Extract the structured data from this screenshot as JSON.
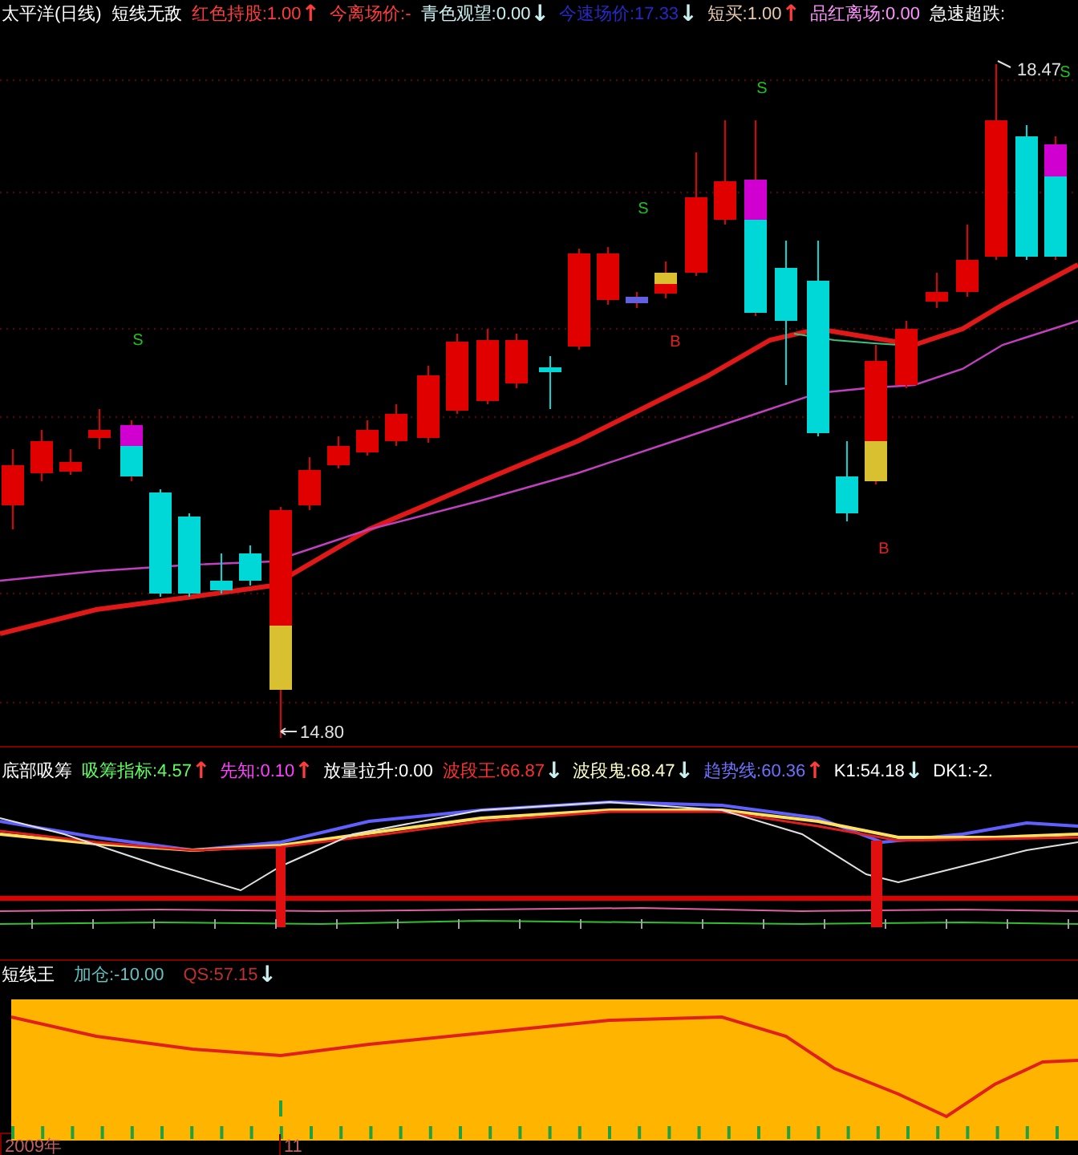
{
  "main_panel": {
    "title": "太平洋(日线)",
    "indicator_name": "短线无敌",
    "indicators": [
      {
        "text": "红色持股:1.00",
        "arrow": {
          "text": "↑",
          "color": "#ff3c3c"
        },
        "color": "#ff3c3c"
      },
      {
        "text": "今离场价:-",
        "color": "#ff3c3c"
      },
      {
        "text": "青色观望:0.00",
        "arrow": {
          "text": "↓",
          "color": "#c8f0f0"
        },
        "color": "#c8f0f0"
      },
      {
        "text": "今速场价:17.33",
        "arrow": {
          "text": "↓",
          "color": "#c8f0f0"
        },
        "color": "#2828c8"
      },
      {
        "text": "短买:1.00",
        "arrow": {
          "text": "↑",
          "color": "#ff3c3c"
        },
        "color": "#e8c8a8"
      },
      {
        "text": "品红离场:0.00",
        "color": "#ff90ff"
      },
      {
        "text": "急速超跌:",
        "color": "#ffffff"
      }
    ],
    "high_label": "18.47",
    "low_label": "14.80",
    "signals": [
      {
        "text": "S",
        "kind": "sell"
      },
      {
        "text": "S",
        "kind": "sell"
      },
      {
        "text": "S",
        "kind": "sell"
      },
      {
        "text": "S",
        "kind": "sell"
      },
      {
        "text": "B",
        "kind": "buy"
      },
      {
        "text": "B",
        "kind": "buy"
      }
    ]
  },
  "accumulation_panel": {
    "title": "底部吸筹",
    "indicators": [
      {
        "text": "吸筹指标:4.57",
        "arrow": {
          "text": "↑",
          "color": "#ff3c3c"
        },
        "color": "#60ff60"
      },
      {
        "text": "先知:0.10",
        "arrow": {
          "text": "↑",
          "color": "#ff3c3c"
        },
        "color": "#ff40ff"
      },
      {
        "text": "放量拉升:0.00",
        "color": "#ffffff"
      },
      {
        "text": "波段王:66.87",
        "arrow": {
          "text": "↓",
          "color": "#c8f0f0"
        },
        "color": "#ff3030"
      },
      {
        "text": "波段鬼:68.47",
        "arrow": {
          "text": "↓",
          "color": "#c8f0f0"
        },
        "color": "#ffffc8"
      },
      {
        "text": "趋势线:60.36",
        "arrow": {
          "text": "↑",
          "color": "#ff3c3c"
        },
        "color": "#7070ff"
      },
      {
        "text": "K1:54.18",
        "arrow": {
          "text": "↓",
          "color": "#c8f0f0"
        },
        "color": "#ffffff"
      },
      {
        "text": "DK1:-2.",
        "color": "#ffffff"
      }
    ]
  },
  "short_term_panel": {
    "title": "短线王",
    "indicators": [
      {
        "text": "加仓:-10.00",
        "color": "#60c0c0"
      },
      {
        "text": "QS:57.15",
        "arrow": {
          "text": "↓",
          "color": "#c8f0f0"
        },
        "color": "#c03030"
      }
    ]
  },
  "time_axis": {
    "labels": [
      "2009年",
      "11"
    ]
  }
}
